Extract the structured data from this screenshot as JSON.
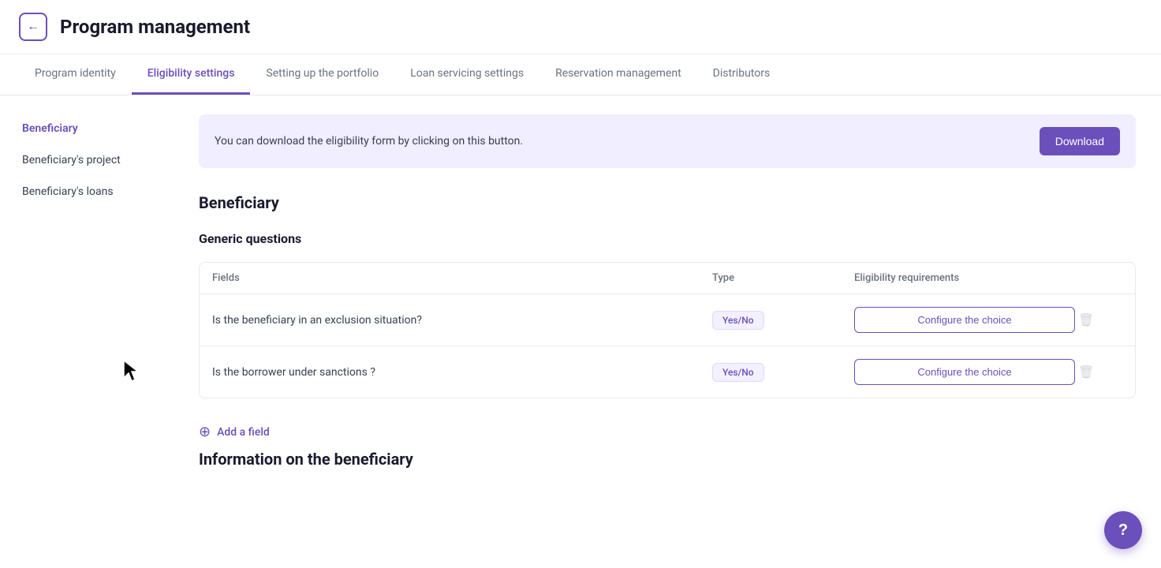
{
  "header": {
    "back_label": "←",
    "title": "Program management"
  },
  "nav": {
    "tabs": [
      {
        "id": "program-identity",
        "label": "Program identity",
        "active": false
      },
      {
        "id": "eligibility-settings",
        "label": "Eligibility settings",
        "active": true
      },
      {
        "id": "setting-up-portfolio",
        "label": "Setting up the portfolio",
        "active": false
      },
      {
        "id": "loan-servicing",
        "label": "Loan servicing settings",
        "active": false
      },
      {
        "id": "reservation-management",
        "label": "Reservation management",
        "active": false
      },
      {
        "id": "distributors",
        "label": "Distributors",
        "active": false
      }
    ]
  },
  "sidebar": {
    "items": [
      {
        "id": "beneficiary",
        "label": "Beneficiary",
        "active": true
      },
      {
        "id": "beneficiary-project",
        "label": "Beneficiary's project",
        "active": false
      },
      {
        "id": "beneficiary-loans",
        "label": "Beneficiary's loans",
        "active": false
      }
    ]
  },
  "content": {
    "banner": {
      "text": "You can download the eligibility form by clicking on this button.",
      "download_label": "Download"
    },
    "section_title": "Beneficiary",
    "subsection_title": "Generic questions",
    "table": {
      "headers": [
        "Fields",
        "Type",
        "Eligibility requirements",
        ""
      ],
      "rows": [
        {
          "field": "Is the beneficiary in an exclusion situation?",
          "type": "Yes/No",
          "configure_label": "Configure the choice"
        },
        {
          "field": "Is the borrower under sanctions ?",
          "type": "Yes/No",
          "configure_label": "Configure the choice"
        }
      ]
    },
    "add_field_label": "Add a field",
    "info_section_title": "Information on the beneficiary"
  },
  "help": {
    "label": "?"
  },
  "colors": {
    "accent": "#6b4fbb",
    "badge_bg": "#f3f0ff",
    "banner_bg": "#f0eeff"
  }
}
